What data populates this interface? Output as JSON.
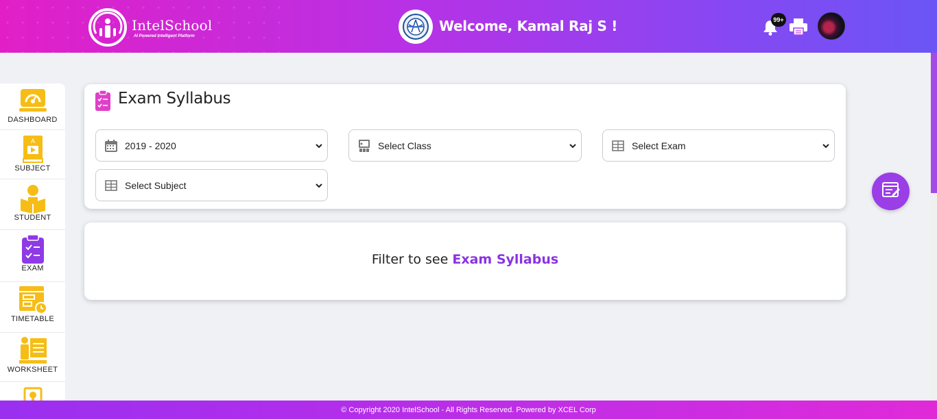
{
  "header": {
    "logo_name": "IntelSchool",
    "logo_tagline": "AI Powered Intelligent Platform",
    "welcome": "Welcome, Kamal Raj S !",
    "notifications_badge": "99+"
  },
  "sidebar": {
    "items": [
      {
        "label": "DASHBOARD",
        "icon": "dashboard-icon"
      },
      {
        "label": "SUBJECT",
        "icon": "subject-icon"
      },
      {
        "label": "STUDENT",
        "icon": "student-icon"
      },
      {
        "label": "EXAM",
        "icon": "exam-icon"
      },
      {
        "label": "TIMETABLE",
        "icon": "timetable-icon"
      },
      {
        "label": "WORKSHEET",
        "icon": "worksheet-icon"
      }
    ]
  },
  "page": {
    "title": "Exam Syllabus"
  },
  "filters": {
    "year": "2019 - 2020",
    "class": "Select Class",
    "exam": "Select Exam",
    "subject": "Select Subject"
  },
  "results": {
    "prefix": "Filter to see",
    "highlight": "Exam Syllabus"
  },
  "footer": {
    "copyright": "© Copyright 2020 IntelSchool - All Rights Reserved. Powered by XCEL Corp"
  },
  "colors": {
    "accent": "#8a33e3",
    "sidebar_icon": "#f6bd16",
    "exam_icon": "#8e3ae6"
  }
}
